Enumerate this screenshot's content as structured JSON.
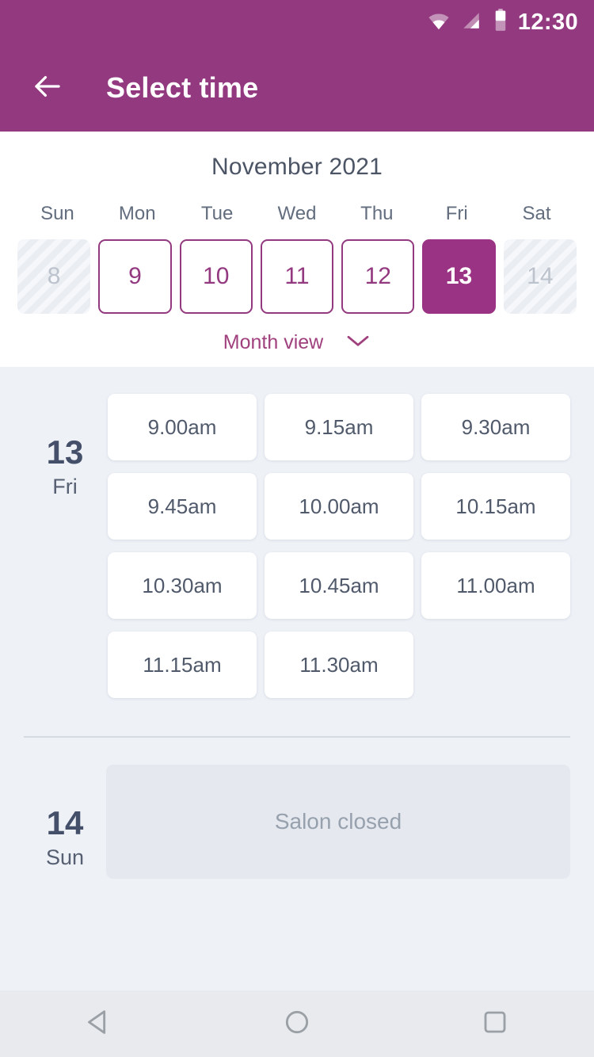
{
  "status_bar": {
    "time": "12:30",
    "icons": [
      "wifi-icon",
      "signal-icon",
      "battery-icon"
    ]
  },
  "app_bar": {
    "back_icon": "arrow-left-icon",
    "title": "Select time"
  },
  "calendar": {
    "month_title": "November 2021",
    "weekdays": [
      "Sun",
      "Mon",
      "Tue",
      "Wed",
      "Thu",
      "Fri",
      "Sat"
    ],
    "days": [
      {
        "number": "8",
        "state": "disabled"
      },
      {
        "number": "9",
        "state": "enabled"
      },
      {
        "number": "10",
        "state": "enabled"
      },
      {
        "number": "11",
        "state": "enabled"
      },
      {
        "number": "12",
        "state": "enabled"
      },
      {
        "number": "13",
        "state": "selected"
      },
      {
        "number": "14",
        "state": "disabled"
      }
    ],
    "month_view_label": "Month view",
    "month_view_icon": "chevron-down-icon"
  },
  "schedule": [
    {
      "day_number": "13",
      "day_of_week": "Fri",
      "slots": [
        "9.00am",
        "9.15am",
        "9.30am",
        "9.45am",
        "10.00am",
        "10.15am",
        "10.30am",
        "10.45am",
        "11.00am",
        "11.15am",
        "11.30am"
      ]
    },
    {
      "day_number": "14",
      "day_of_week": "Sun",
      "closed_message": "Salon closed"
    }
  ],
  "nav_bar": {
    "back_icon": "triangle-back-icon",
    "home_icon": "circle-home-icon",
    "recents_icon": "square-recents-icon"
  },
  "colors": {
    "brand_purple": "#93397f",
    "selected_purple": "#9b3384",
    "page_background": "#eef1f6",
    "card_white": "#ffffff",
    "text_dark": "#44506a",
    "text_muted": "#97a0ad"
  }
}
